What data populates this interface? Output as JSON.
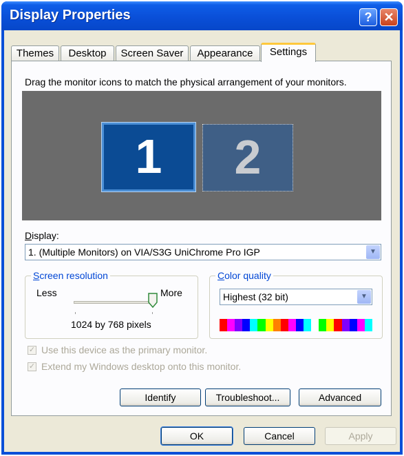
{
  "window": {
    "title": "Display Properties",
    "help_label": "?",
    "close_label": "✕"
  },
  "tabs": [
    {
      "label": "Themes"
    },
    {
      "label": "Desktop"
    },
    {
      "label": "Screen Saver"
    },
    {
      "label": "Appearance"
    },
    {
      "label": "Settings",
      "active": true
    }
  ],
  "instructions": "Drag the monitor icons to match the physical arrangement of your monitors.",
  "monitors": [
    {
      "label": "1",
      "selected": true
    },
    {
      "label": "2",
      "selected": false
    }
  ],
  "display": {
    "label": "Display:",
    "value": "1. (Multiple Monitors) on VIA/S3G UniChrome Pro IGP"
  },
  "resolution": {
    "group_title": "Screen resolution",
    "less_label": "Less",
    "more_label": "More",
    "value": "1024 by 768 pixels",
    "slider_fraction": 1.0
  },
  "color_quality": {
    "group_title": "Color quality",
    "value": "Highest (32 bit)",
    "palette": [
      "#ff0000",
      "#ff00ff",
      "#8000ff",
      "#0000ff",
      "#00ffff",
      "#00ff00",
      "#ffff00",
      "#ff8000",
      "#ff0000",
      "#ff00ff",
      "#0000ff",
      "#00ffff",
      "#ffffff",
      "#00ff00",
      "#ffff00",
      "#ff0000",
      "#8000ff",
      "#0000ff",
      "#ff00ff",
      "#00ffff"
    ]
  },
  "checkboxes": [
    {
      "label": "Use this device as the primary monitor.",
      "checked": true,
      "enabled": false
    },
    {
      "label": "Extend my Windows desktop onto this monitor.",
      "checked": true,
      "enabled": false
    }
  ],
  "panel_buttons": {
    "identify": "Identify",
    "troubleshoot": "Troubleshoot...",
    "advanced": "Advanced"
  },
  "dialog_buttons": {
    "ok": "OK",
    "cancel": "Cancel",
    "apply": "Apply"
  },
  "colors": {
    "title_bar": "#0a4fd8",
    "dialog_bg": "#ece9d8",
    "monitor_area": "#6b6b6b",
    "monitor_selected": "#0b4b94",
    "monitor_other": "#3f5f86"
  }
}
